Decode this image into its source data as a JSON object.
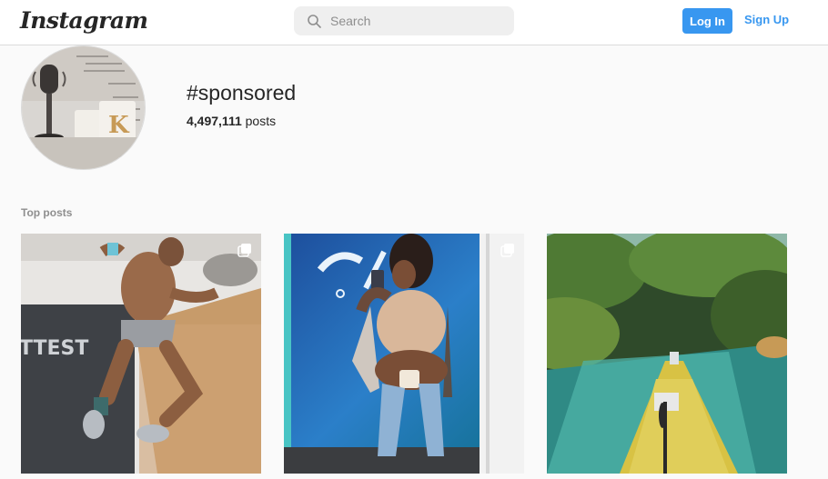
{
  "header": {
    "logo_text": "Instagram",
    "search_placeholder": "Search",
    "login_label": "Log In",
    "signup_label": "Sign Up"
  },
  "hashtag": {
    "title": "#sponsored",
    "post_count": "4,497,111",
    "post_count_suffix": " posts"
  },
  "top_posts": {
    "section_label": "Top posts",
    "posts": [
      {
        "alt": "Athlete jumping in gym",
        "multi_image": true
      },
      {
        "alt": "Mirror selfie in blue room",
        "multi_image": true
      },
      {
        "alt": "Paddleboard on clear river",
        "multi_image": false
      }
    ]
  },
  "colors": {
    "accent": "#3897f0",
    "text": "#262626",
    "muted": "#8e8e8e",
    "background": "#fafafa"
  }
}
